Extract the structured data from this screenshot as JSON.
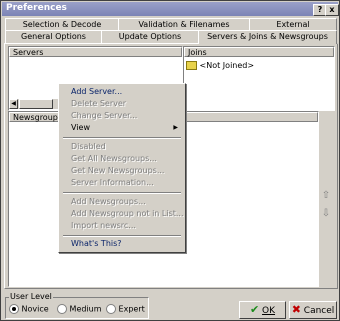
{
  "window": {
    "title": "Preferences",
    "help_glyph": "?",
    "close_glyph": "x"
  },
  "tabs_row1": [
    "Selection & Decode",
    "Validation & Filenames",
    "External"
  ],
  "tabs_row2": [
    "General Options",
    "Update Options",
    "Servers & Joins & Newsgroups"
  ],
  "servers": {
    "header": "Servers"
  },
  "joins": {
    "header": "Joins",
    "items": [
      "<Not Joined>"
    ]
  },
  "newsgroups": {
    "header": "Newsgroups"
  },
  "context_menu": {
    "group1": [
      {
        "label": "Add Server...",
        "disabled": false,
        "highlight": true
      },
      {
        "label": "Delete Server",
        "disabled": true
      },
      {
        "label": "Change Server...",
        "disabled": true
      },
      {
        "label": "View",
        "disabled": false,
        "submenu": true
      }
    ],
    "group2": [
      {
        "label": "Disabled",
        "disabled": true
      },
      {
        "label": "Get All Newsgroups...",
        "disabled": true
      },
      {
        "label": "Get New Newsgroups...",
        "disabled": true
      },
      {
        "label": "Server Information...",
        "disabled": true
      }
    ],
    "group3": [
      {
        "label": "Add Newsgroups...",
        "disabled": true
      },
      {
        "label": "Add Newsgroup not in List...",
        "disabled": true
      },
      {
        "label": "Import newsrc...",
        "disabled": true
      }
    ],
    "group4": [
      {
        "label": "What's This?",
        "disabled": false
      }
    ]
  },
  "user_level": {
    "label": "User Level",
    "options": [
      "Novice",
      "Medium",
      "Expert"
    ],
    "selected": "Novice"
  },
  "buttons": {
    "ok": "OK",
    "cancel": "Cancel"
  },
  "colors": {
    "titlebar": "#7c84b6",
    "menu_highlight_text": "#0a246a",
    "ok_check": "#1a8a1a",
    "cancel_x": "#c00000"
  }
}
